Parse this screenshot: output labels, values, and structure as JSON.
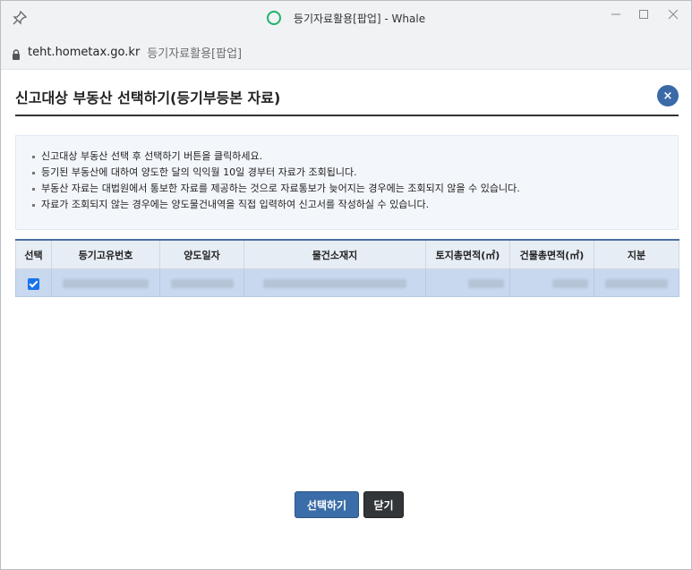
{
  "window": {
    "title": "등기자료활용[팝업] - Whale"
  },
  "address": {
    "domain": "teht.hometax.go.kr",
    "page_title": "등기자료활용[팝업]"
  },
  "dialog": {
    "title": "신고대상 부동산 선택하기(등기부등본 자료)",
    "close_label": "×"
  },
  "notices": [
    "신고대상 부동산 선택 후 선택하기 버튼을 클릭하세요.",
    "등기된 부동산에 대하여 양도한 달의 익익월 10일 경부터 자료가 조회됩니다.",
    "부동산 자료는 대법원에서 통보한 자료를 제공하는 것으로 자료통보가 늦어지는 경우에는 조회되지 않을 수 있습니다.",
    "자료가 조회되지 않는 경우에는 양도물건내역을 직접 입력하여 신고서를 작성하실 수 있습니다."
  ],
  "table": {
    "headers": [
      "선택",
      "등기고유번호",
      "양도일자",
      "물건소재지",
      "토지총면적(㎡)",
      "건물총면적(㎡)",
      "지분"
    ],
    "rows": [
      {
        "selected": true
      }
    ]
  },
  "buttons": {
    "select_label": "선택하기",
    "close_label": "닫기"
  },
  "colors": {
    "accent": "#3b6ea8",
    "row_selected": "#c7d8ef",
    "checkbox": "#1a73e8"
  }
}
